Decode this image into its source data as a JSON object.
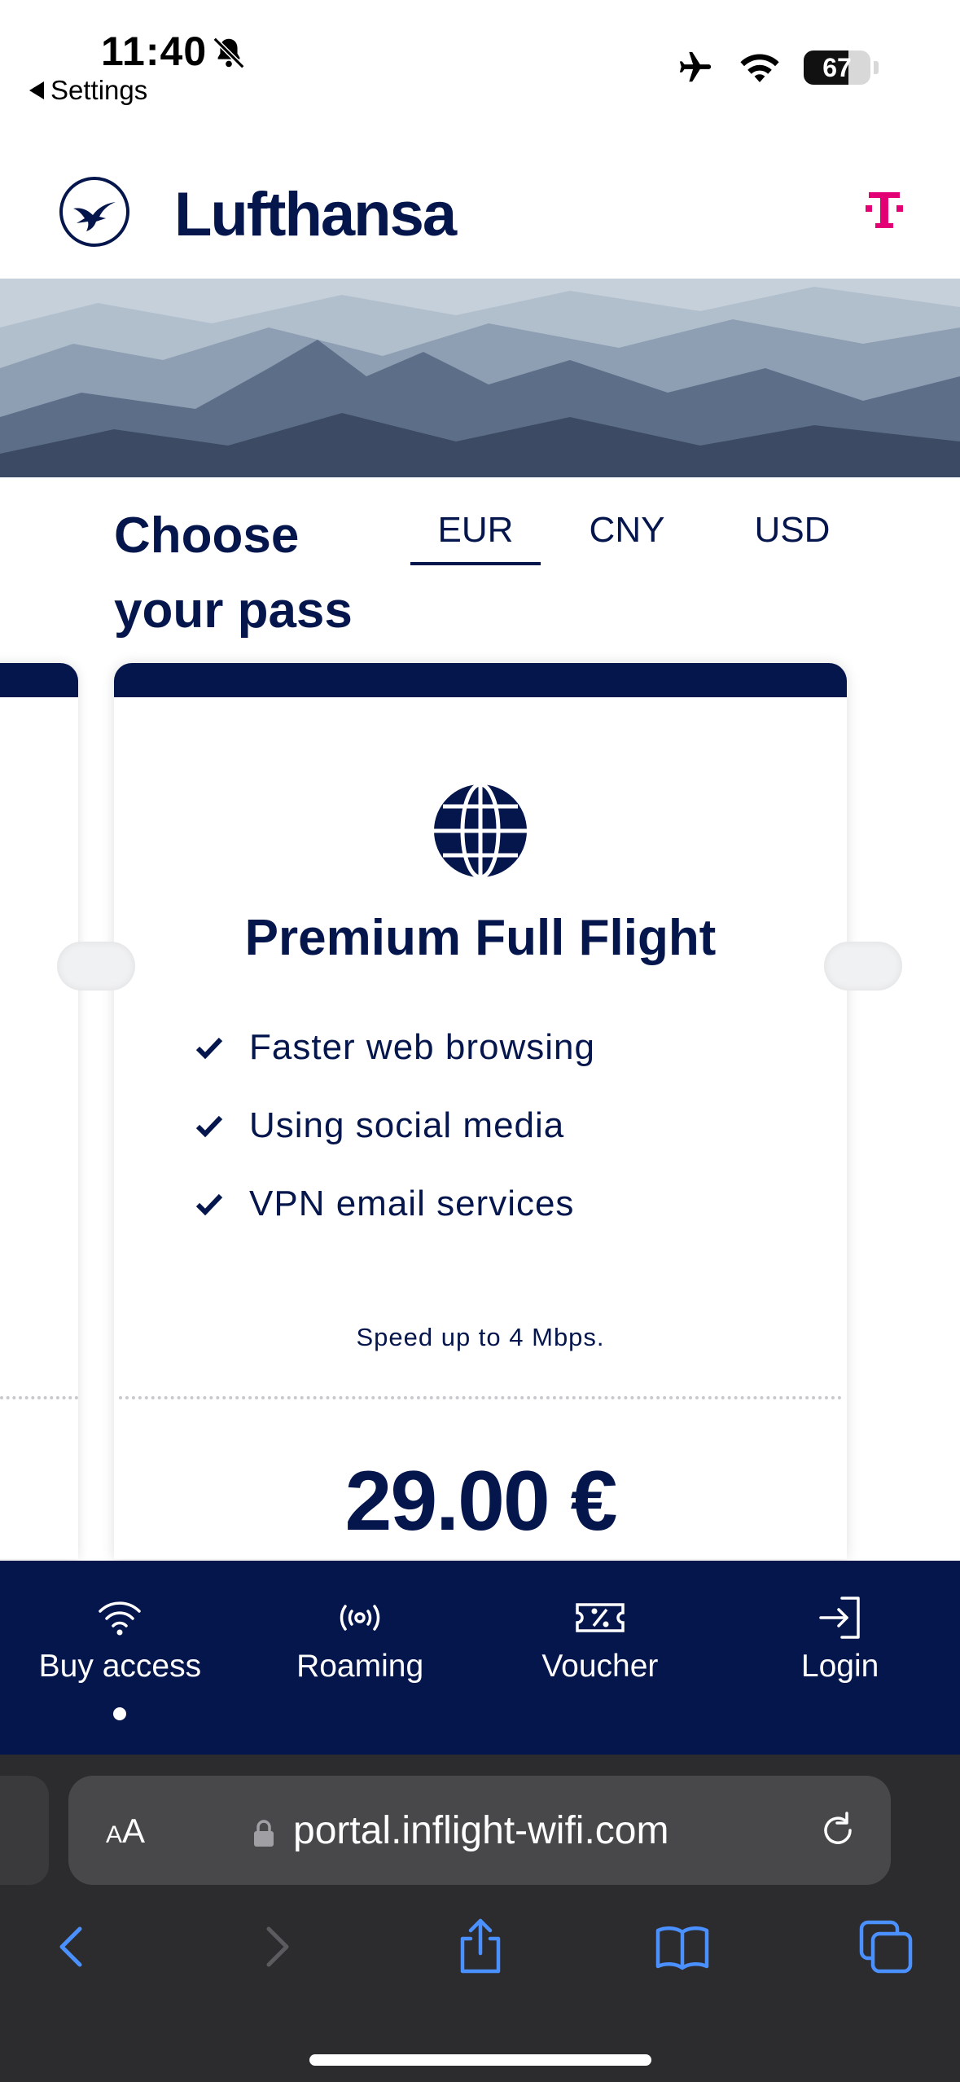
{
  "status_bar": {
    "time": "11:40",
    "back_label": "Settings",
    "battery": "67"
  },
  "header": {
    "brand": "Lufthansa"
  },
  "pass_section": {
    "title": "Choose your pass",
    "currencies": [
      "EUR",
      "CNY",
      "USD"
    ],
    "selected_currency": "EUR"
  },
  "card": {
    "title": "Premium Full Flight",
    "features": [
      "Faster web browsing",
      "Using social media",
      "VPN email services"
    ],
    "speed_note": "Speed up to 4 Mbps.",
    "price": "29.00 €"
  },
  "bottom_nav": {
    "items": [
      {
        "label": "Buy access",
        "icon": "wifi-icon",
        "active": true
      },
      {
        "label": "Roaming",
        "icon": "roaming-icon",
        "active": false
      },
      {
        "label": "Voucher",
        "icon": "voucher-icon",
        "active": false
      },
      {
        "label": "Login",
        "icon": "login-icon",
        "active": false
      }
    ]
  },
  "browser": {
    "text_size_label": "AA",
    "url": "portal.inflight-wifi.com"
  },
  "colors": {
    "brand_navy": "#05164d",
    "telekom_magenta": "#e20074",
    "safari_dark": "#2c2c2e",
    "ios_blue": "#4a90ff"
  }
}
